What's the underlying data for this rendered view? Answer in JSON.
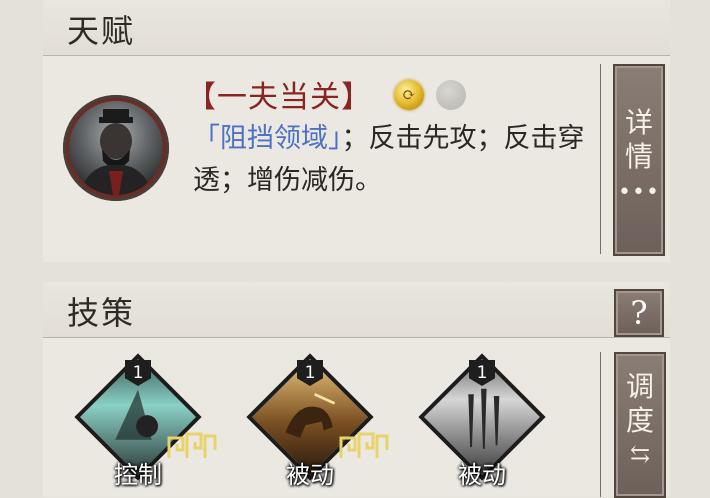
{
  "talent": {
    "title": "天赋",
    "name": "【一夫当关】",
    "coin_gold_icon": "⟳",
    "desc_highlight": "「阻挡领域」",
    "desc_rest": "；反击先攻；反击穿透；增伤减伤。",
    "detail_button": [
      "详",
      "情"
    ],
    "detail_dots": "•••"
  },
  "skills": {
    "title": "技策",
    "help_label": "?",
    "items": [
      {
        "level": "1",
        "label": "控制",
        "badge": true
      },
      {
        "level": "1",
        "label": "被动",
        "badge": true
      },
      {
        "level": "1",
        "label": "被动",
        "badge": false
      }
    ],
    "adjust_button": [
      "调",
      "度"
    ],
    "adjust_arrows": "⇆"
  },
  "colors": {
    "talent_name": "#8a2421",
    "highlight": "#4d70c9",
    "button": "#7a6d66"
  }
}
